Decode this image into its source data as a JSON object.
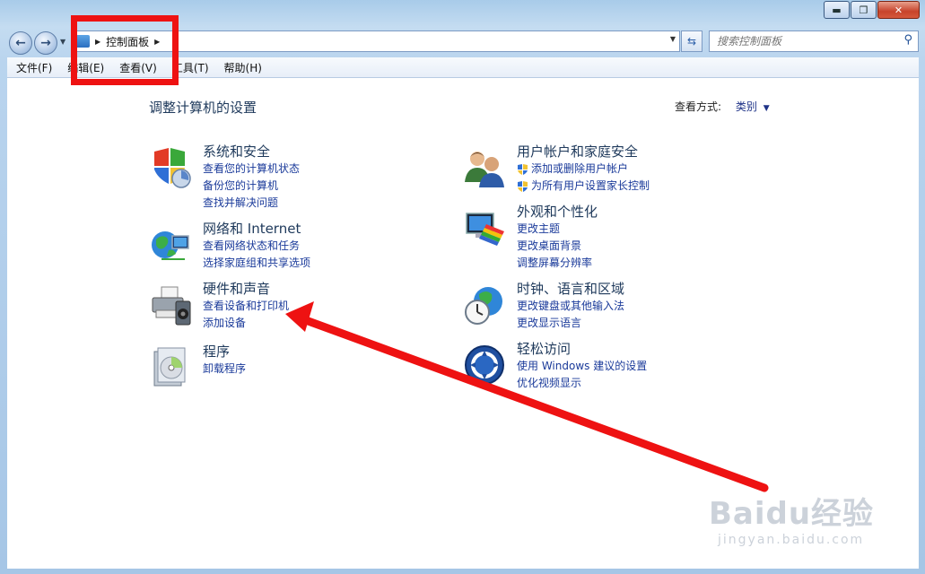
{
  "window": {
    "buttons": {
      "minimize": "▬",
      "maximize": "❐",
      "close": "✕"
    }
  },
  "nav": {
    "breadcrumb": [
      "控制面板"
    ],
    "search_placeholder": "搜索控制面板"
  },
  "menu": [
    "文件(F)",
    "编辑(E)",
    "查看(V)",
    "工具(T)",
    "帮助(H)"
  ],
  "main": {
    "title": "调整计算机的设置",
    "view_by_label": "查看方式:",
    "view_by_value": "类别",
    "categories": [
      {
        "icon": "security-shield-icon",
        "title": "系统和安全",
        "links": [
          "查看您的计算机状态",
          "备份您的计算机",
          "查找并解决问题"
        ]
      },
      {
        "icon": "network-globe-icon",
        "title": "网络和 Internet",
        "links": [
          "查看网络状态和任务",
          "选择家庭组和共享选项"
        ]
      },
      {
        "icon": "printer-speaker-icon",
        "title": "硬件和声音",
        "links": [
          "查看设备和打印机",
          "添加设备"
        ]
      },
      {
        "icon": "programs-disc-icon",
        "title": "程序",
        "links": [
          "卸载程序"
        ]
      },
      {
        "icon": "users-icon",
        "title": "用户帐户和家庭安全",
        "links": [
          "添加或删除用户帐户",
          "为所有用户设置家长控制"
        ]
      },
      {
        "icon": "monitor-palette-icon",
        "title": "外观和个性化",
        "links": [
          "更改主题",
          "更改桌面背景",
          "调整屏幕分辨率"
        ]
      },
      {
        "icon": "clock-globe-icon",
        "title": "时钟、语言和区域",
        "links": [
          "更改键盘或其他输入法",
          "更改显示语言"
        ]
      },
      {
        "icon": "ease-of-access-icon",
        "title": "轻松访问",
        "links": [
          "使用 Windows 建议的设置",
          "优化视频显示"
        ]
      }
    ]
  },
  "watermark": {
    "line1": "Baidu经验",
    "line2": "jingyan.baidu.com"
  },
  "colors": {
    "annotation": "#ee1212",
    "link": "#1a3a9a",
    "heading": "#1e395b"
  }
}
